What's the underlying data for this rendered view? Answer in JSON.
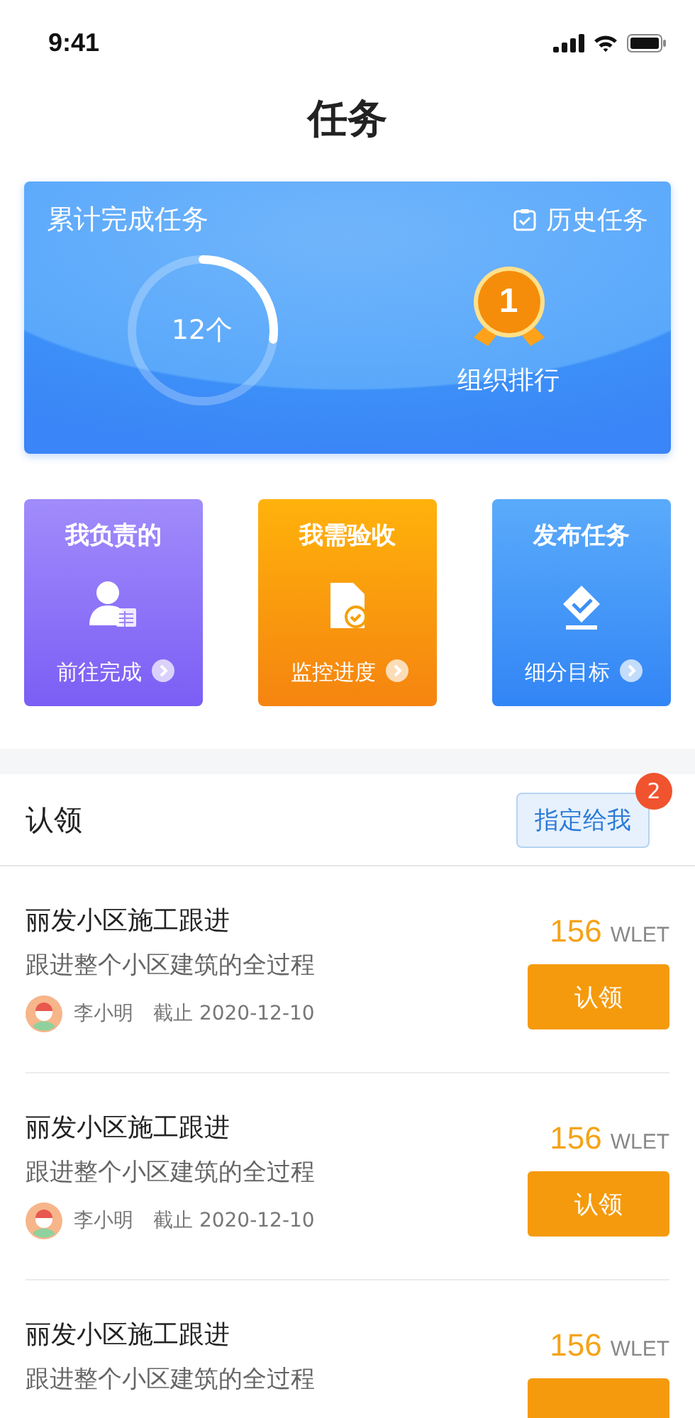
{
  "status_bar": {
    "time": "9:41"
  },
  "title": "任务",
  "summary": {
    "title": "累计完成任务",
    "history_link": "历史任务",
    "count": "12个",
    "level": 0.27,
    "rank": "1",
    "rank_label": "组织排行"
  },
  "tiles": [
    {
      "kind": "person",
      "title": "我负责的",
      "action": "前往完成"
    },
    {
      "kind": "document",
      "title": "我需验收",
      "action": "监控进度"
    },
    {
      "kind": "publish",
      "title": "发布任务",
      "action": "细分目标"
    }
  ],
  "section": {
    "title": "认领",
    "assign_button": "指定给我",
    "badge": "2"
  },
  "tasks": [
    {
      "title": "丽发小区施工跟进",
      "description": "跟进整个小区建筑的全过程",
      "owner": "李小明",
      "deadline": "截止 2020-12-10",
      "amount": "156",
      "unit": "WLET",
      "button": "认领"
    },
    {
      "title": "丽发小区施工跟进",
      "description": "跟进整个小区建筑的全过程",
      "owner": "李小明",
      "deadline": "截止 2020-12-10",
      "amount": "156",
      "unit": "WLET",
      "button": "认领"
    },
    {
      "title": "丽发小区施工跟进",
      "description": "跟进整个小区建筑的全过程",
      "amount": "156",
      "unit": "WLET"
    }
  ]
}
